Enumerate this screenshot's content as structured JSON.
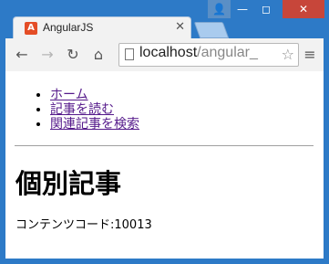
{
  "browser": {
    "tab_title": "AngularJS",
    "tab_favicon": "angularjs-icon",
    "url_host": "localhost",
    "url_path": "/angular_",
    "colors": {
      "titlebar": "#2d7ac7",
      "close": "#c7463a",
      "link": "#551a8b"
    }
  },
  "page": {
    "nav_links": [
      "ホーム",
      "記事を読む",
      "関連記事を検索"
    ],
    "heading": "個別記事",
    "content_code_label": "コンテンツコード:",
    "content_code_value": "10013"
  }
}
